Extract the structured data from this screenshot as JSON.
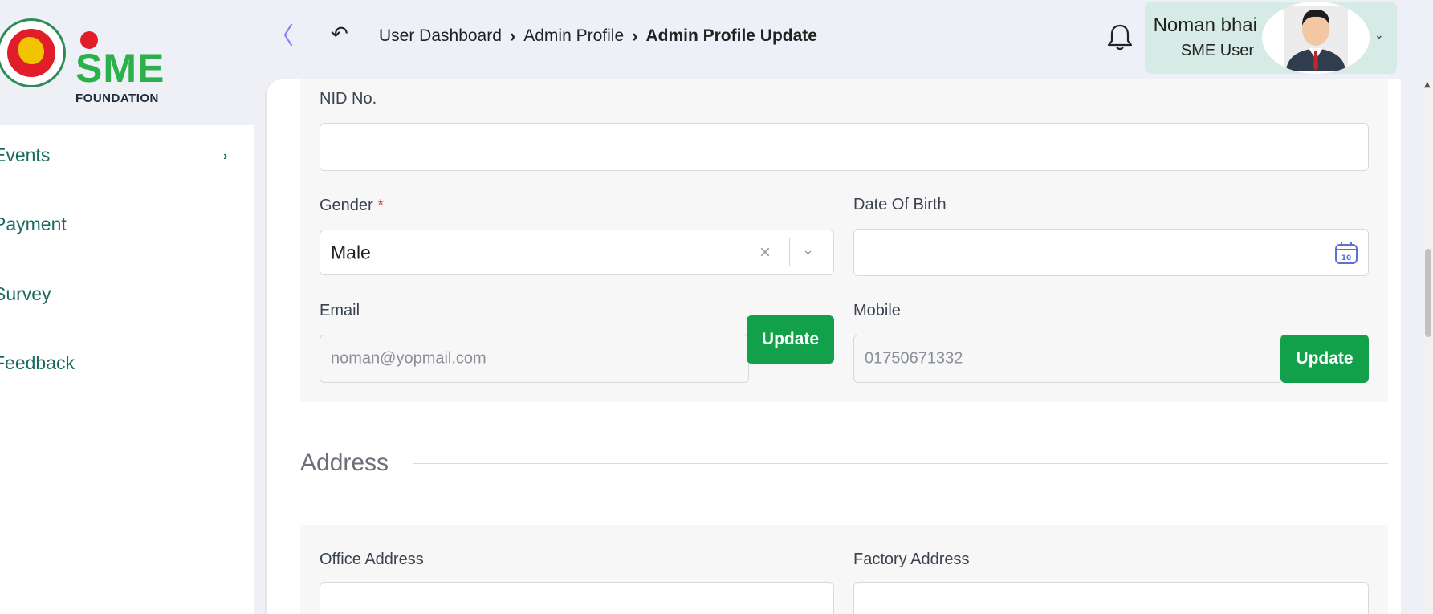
{
  "header": {
    "collapse_symbol": "〈",
    "back_symbol": "↶",
    "breadcrumb": [
      "User Dashboard",
      "Admin Profile",
      "Admin Profile Update"
    ],
    "user": {
      "name": "Noman bhai",
      "role": "SME User"
    },
    "caret": "⌄"
  },
  "logo": {
    "text": "SME",
    "subtext": "FOUNDATION"
  },
  "sidebar": {
    "items": [
      {
        "label": "Events",
        "has_children": true
      },
      {
        "label": "Payment",
        "has_children": false
      },
      {
        "label": "Survey",
        "has_children": false
      },
      {
        "label": "Feedback",
        "has_children": false
      }
    ],
    "chevron": "›"
  },
  "form": {
    "nid": {
      "label": "NID No.",
      "value": ""
    },
    "gender": {
      "label": "Gender",
      "required_mark": "*",
      "value": "Male",
      "clear": "×",
      "arrow": "⌄"
    },
    "dob": {
      "label": "Date Of Birth",
      "value": "",
      "calendar_day": "10"
    },
    "email": {
      "label": "Email",
      "value": "noman@yopmail.com",
      "button": "Update"
    },
    "mobile": {
      "label": "Mobile",
      "value": "01750671332",
      "button": "Update"
    }
  },
  "address": {
    "title": "Address",
    "office": {
      "label": "Office Address"
    },
    "factory": {
      "label": "Factory Address"
    }
  },
  "colors": {
    "brand_green": "#13a04a",
    "sidebar_text": "#1b6b62",
    "user_box": "#d7ebe6",
    "accent_purple": "#8b7cf6"
  }
}
